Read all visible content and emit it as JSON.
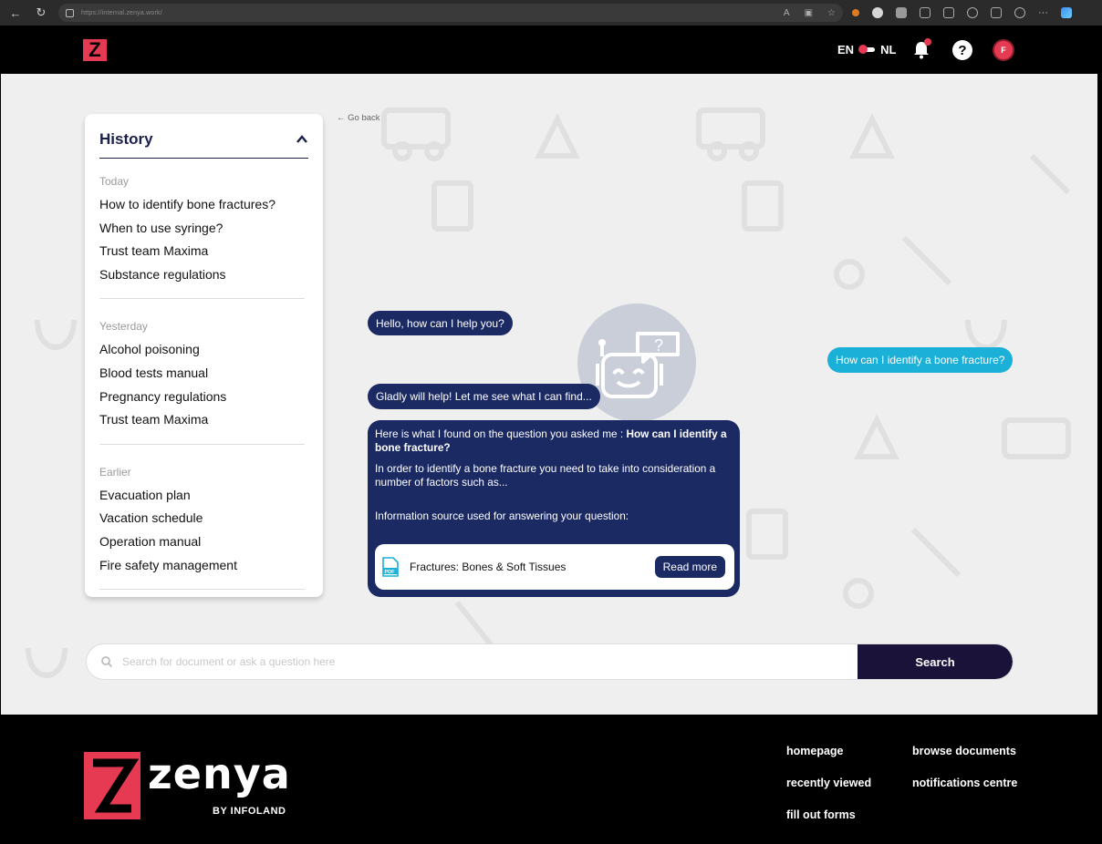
{
  "browser": {
    "url": "https://internal.zenya.work/"
  },
  "header": {
    "logo_letter": "Z",
    "lang_en": "EN",
    "lang_nl": "NL",
    "help": "?",
    "avatar_initial": "F",
    "accent_color": "#e63a52"
  },
  "history": {
    "title": "History",
    "groups": [
      {
        "label": "Today",
        "items": [
          "How to identify bone fractures?",
          "When to use syringe?",
          "Trust team Maxima",
          "Substance regulations"
        ]
      },
      {
        "label": "Yesterday",
        "items": [
          "Alcohol poisoning",
          "Blood tests manual",
          "Pregnancy regulations",
          "Trust team Maxima"
        ]
      },
      {
        "label": "Earlier",
        "items": [
          "Evacuation plan",
          "Vacation schedule",
          "Operation manual",
          "Fire safety management"
        ]
      }
    ]
  },
  "chat": {
    "go_back": "← Go back",
    "bot_greeting": "Hello, how can I help you?",
    "user_question": "How can I identify a bone fracture?",
    "bot_ack": "Gladly will help! Let me see what I can find...",
    "answer_intro": "Here is what I found on the question you asked me : ",
    "answer_question": "How can I identify a bone fracture?",
    "answer_body": "In order to identify a bone fracture you need to take into consideration a number of factors such as...",
    "source_label": "Information source used for answering your question:",
    "source_title": "Fractures: Bones & Soft Tissues",
    "read_more": "Read more",
    "bot_color": "#1b2a63",
    "user_color": "#1ab0d8"
  },
  "search": {
    "placeholder": "Search for document or ask a question here",
    "button": "Search"
  },
  "footer": {
    "brand": "zenya",
    "by": "BY INFOLAND",
    "links": [
      "homepage",
      "browse documents",
      "recently viewed",
      "notifications centre",
      "fill out forms"
    ]
  }
}
